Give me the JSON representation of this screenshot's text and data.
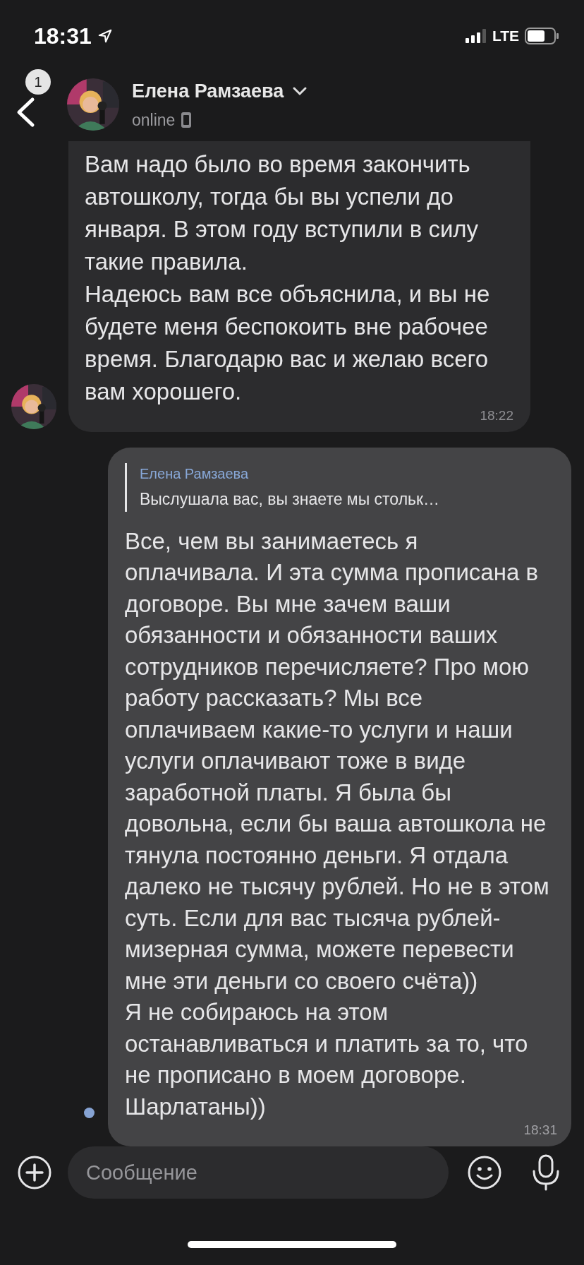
{
  "status_bar": {
    "time": "18:31",
    "network": "LTE"
  },
  "header": {
    "back_badge": "1",
    "contact_name": "Елена Рамзаева",
    "status": "online"
  },
  "messages": [
    {
      "kind": "incoming",
      "text": "Вам надо было во время закончить автошколу, тогда бы вы успели до января. В этом году вступили в силу такие правила.\nНадеюсь вам все объяснила, и вы не будете меня беспокоить вне рабочее время. Благодарю вас и желаю всего вам хорошего.",
      "time": "18:22"
    },
    {
      "kind": "outgoing",
      "reply": {
        "author": "Елена Рамзаева",
        "text": "Выслушала вас, вы знаете мы стольк…"
      },
      "text": "Все, чем вы занимаетесь я оплачивала. И эта сумма прописана в договоре. Вы мне зачем ваши обязанности и обязанности ваших сотрудников перечисляете? Про мою работу рассказать? Мы все оплачиваем какие-то услуги и наши услуги оплачивают тоже в виде заработной платы. Я была бы довольна, если бы ваша автошкола не тянула постоянно деньги. Я отдала далеко не тысячу рублей. Но не в этом суть. Если для вас тысяча рублей-мизерная сумма, можете перевести мне эти деньги со своего счёта))\nЯ не собираюсь на этом останавливаться и платить за то, что не прописано в моем договоре. Шарлатаны))",
      "time": "18:31",
      "unread": true
    }
  ],
  "composer": {
    "placeholder": "Сообщение"
  }
}
